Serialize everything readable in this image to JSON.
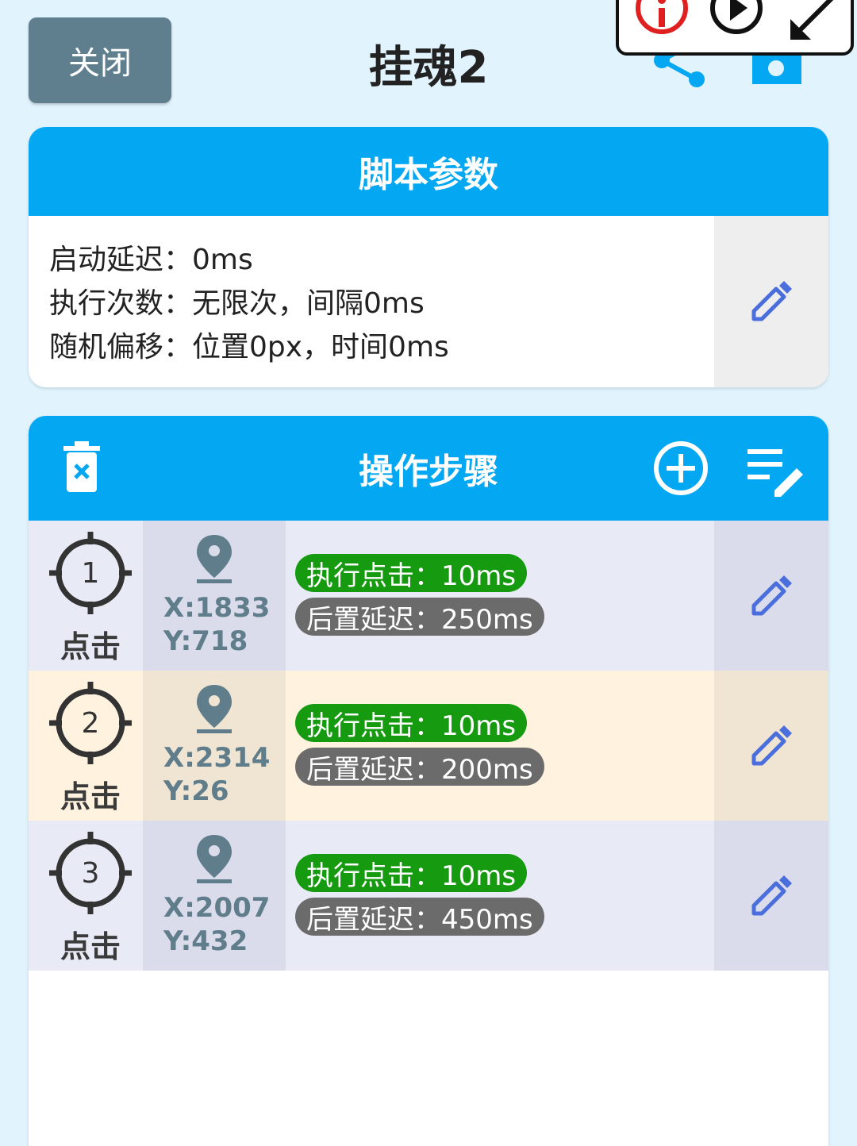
{
  "header": {
    "close_label": "关闭",
    "title": "挂魂2",
    "share_icon": "share-icon",
    "save_icon": "save-icon"
  },
  "floating_toolbar": {
    "icons": [
      "info-icon",
      "play-icon",
      "expand-icon"
    ],
    "accent_color": "#e02020"
  },
  "params": {
    "title": "脚本参数",
    "lines": [
      "启动延迟：0ms",
      "执行次数：无限次，间隔0ms",
      "随机偏移：位置0px，时间0ms"
    ]
  },
  "steps": {
    "title": "操作步骤",
    "header_icons": [
      "trash-icon",
      "add-circle-icon",
      "edit-list-icon"
    ],
    "items": [
      {
        "num": "1",
        "type": "点击",
        "x": "X:1833",
        "y": "Y:718",
        "exec": "执行点击：10ms",
        "delay": "后置延迟：250ms"
      },
      {
        "num": "2",
        "type": "点击",
        "x": "X:2314",
        "y": "Y:26",
        "exec": "执行点击：10ms",
        "delay": "后置延迟：200ms"
      },
      {
        "num": "3",
        "type": "点击",
        "x": "X:2007",
        "y": "Y:432",
        "exec": "执行点击：10ms",
        "delay": "后置延迟：450ms"
      }
    ]
  },
  "colors": {
    "header_blue": "#04a7f1",
    "pill_green": "#159a10",
    "pill_gray": "#6b6b6b",
    "edit_icon": "#4a6fdc"
  }
}
